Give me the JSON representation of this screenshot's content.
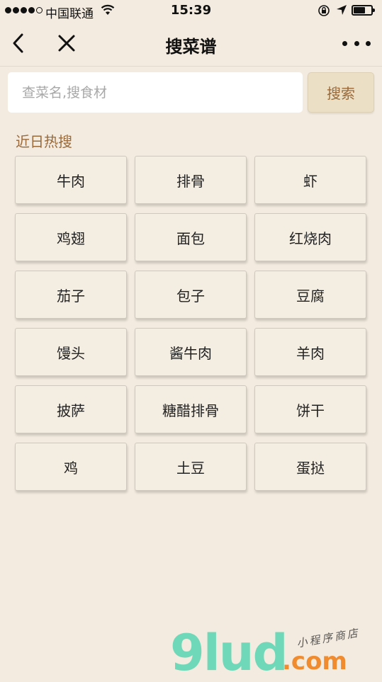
{
  "status_bar": {
    "carrier": "中国联通",
    "time": "15:39",
    "battery_level": 0.7
  },
  "nav": {
    "title": "搜菜谱"
  },
  "search": {
    "placeholder": "查菜名,搜食材",
    "value": "",
    "button_label": "搜索"
  },
  "hot": {
    "title": "近日热搜",
    "items": [
      "牛肉",
      "排骨",
      "虾",
      "鸡翅",
      "面包",
      "红烧肉",
      "茄子",
      "包子",
      "豆腐",
      "馒头",
      "酱牛肉",
      "羊肉",
      "披萨",
      "糖醋排骨",
      "饼干",
      "鸡",
      "土豆",
      "蛋挞"
    ]
  },
  "watermark": {
    "logo": "9lud",
    "domain": ".com",
    "tagline": "小程序商店"
  },
  "colors": {
    "background": "#f3ebdf",
    "accent_text": "#9a6a3a",
    "search_button_bg": "#ebdfc6"
  }
}
